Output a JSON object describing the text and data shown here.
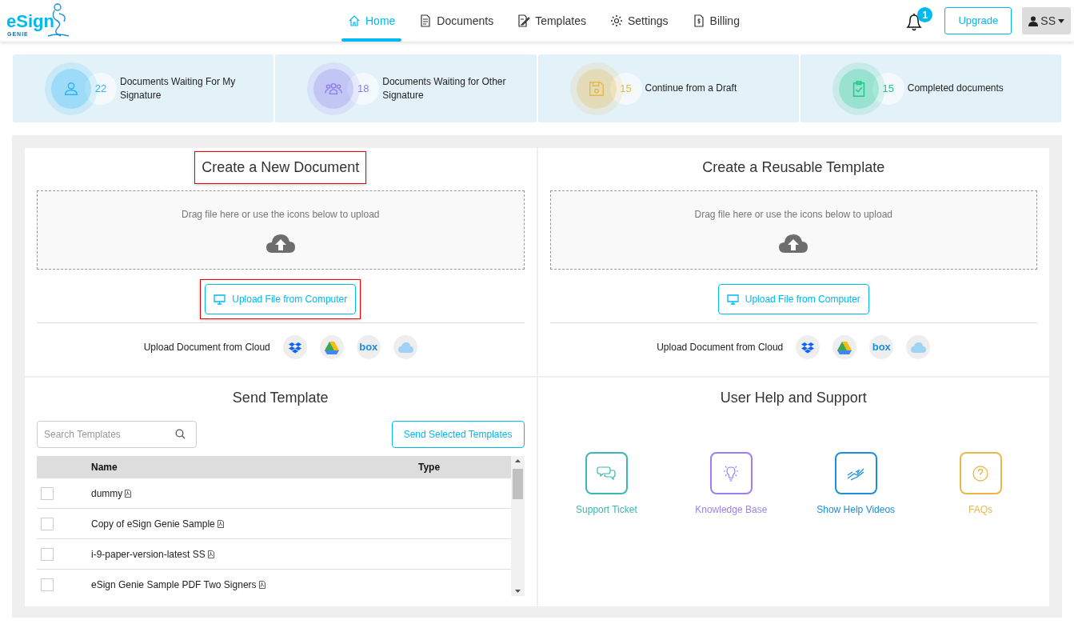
{
  "logo": {
    "text": "eSign",
    "subtext": "GENIE"
  },
  "nav": [
    {
      "label": "Home",
      "selected": true
    },
    {
      "label": "Documents",
      "selected": false
    },
    {
      "label": "Templates",
      "selected": false
    },
    {
      "label": "Settings",
      "selected": false
    },
    {
      "label": "Billing",
      "selected": false
    }
  ],
  "notifications": {
    "count": "1"
  },
  "upgrade_button": "Upgrade",
  "user_menu": {
    "initials": "SS"
  },
  "stats": [
    {
      "count": "22",
      "label": "Documents Waiting For My Signature",
      "color": "#29b6f6"
    },
    {
      "count": "18",
      "label": "Documents Waiting for Other Signature",
      "color": "#8c7cf0"
    },
    {
      "count": "15",
      "label": "Continue from a Draft",
      "color": "#e8b84a"
    },
    {
      "count": "15",
      "label": "Completed documents",
      "color": "#1fc98a"
    }
  ],
  "upload_panels": [
    {
      "title": "Create a New Document",
      "title_highlighted": true,
      "dropzone_text": "Drag file here or use the icons below to upload",
      "upload_button": "Upload File from Computer",
      "upload_highlighted": true,
      "cloud_label": "Upload Document from Cloud",
      "clouds": [
        {
          "kind": "dropbox"
        },
        {
          "kind": "drive"
        },
        {
          "kind": "box",
          "label": "box"
        },
        {
          "kind": "cloud"
        }
      ]
    },
    {
      "title": "Create a Reusable Template",
      "title_highlighted": false,
      "dropzone_text": "Drag file here or use the icons below to upload",
      "upload_button": "Upload File from Computer",
      "upload_highlighted": false,
      "cloud_label": "Upload Document from Cloud",
      "clouds": [
        {
          "kind": "dropbox"
        },
        {
          "kind": "drive"
        },
        {
          "kind": "box",
          "label": "box"
        },
        {
          "kind": "cloud"
        }
      ]
    }
  ],
  "send_template": {
    "title": "Send Template",
    "search": {
      "placeholder": "Search Templates"
    },
    "send_button": "Send Selected Templates",
    "table": {
      "columns": [
        "Name",
        "Type"
      ],
      "rows": [
        {
          "name": "dummy",
          "checked": false
        },
        {
          "name": "Copy of eSign Genie Sample",
          "checked": false
        },
        {
          "name": "i-9-paper-version-latest SS",
          "checked": false
        },
        {
          "name": "eSign Genie Sample PDF Two Signers",
          "checked": false
        }
      ]
    }
  },
  "help": {
    "title": "User Help and Support",
    "items": [
      {
        "label": "Support Ticket",
        "color": "#3bb5b5"
      },
      {
        "label": "Knowledge Base",
        "color": "#9b7ff5"
      },
      {
        "label": "Show Help Videos",
        "color": "#1b8fdc"
      },
      {
        "label": "FAQs",
        "color": "#e8b84a"
      }
    ]
  }
}
